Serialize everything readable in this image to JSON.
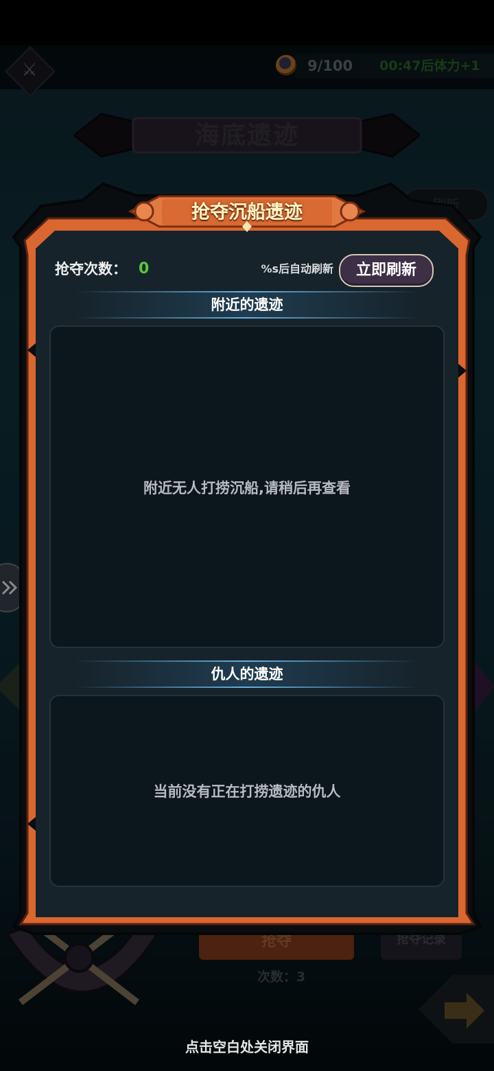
{
  "top_bar": {
    "stamina_count": "9/100",
    "stamina_timer": "00:47后体力+1"
  },
  "background": {
    "page_title": "海底遗迹",
    "refresh_label": "刷新",
    "grab_label": "抢夺",
    "record_label": "抢夺记录",
    "count_label": "次数：3"
  },
  "dialog": {
    "title": "抢夺沉船遗迹",
    "rob_count_label": "抢夺次数：",
    "rob_count_value": "0",
    "auto_refresh_text": "%s后自动刷新",
    "refresh_button_label": "立即刷新",
    "nearby_section_title": "附近的遗迹",
    "nearby_empty_text": "附近无人打捞沉船,请稍后再查看",
    "enemy_section_title": "仇人的遗迹",
    "enemy_empty_text": "当前没有正在打捞遗迹的仇人"
  },
  "close_hint": "点击空白处关闭界面",
  "colors": {
    "frame_orange": "#d9672f",
    "panel_bg": "#16232b",
    "count_green": "#58c842",
    "timer_green": "#2e6b2a"
  }
}
